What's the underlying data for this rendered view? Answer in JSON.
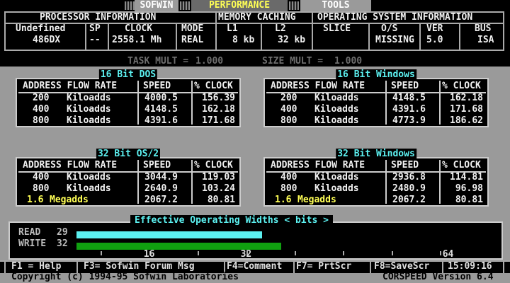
{
  "menu": {
    "items": [
      "SOFWIN",
      "PERFORMANCE",
      "TOOLS"
    ]
  },
  "info": {
    "headers": [
      "PROCESSOR INFORMATION",
      "MEMORY CACHING",
      "OPERATING SYSTEM INFORMATION"
    ],
    "labels": [
      "Undefined",
      "SP",
      "CLOCK",
      "MODE",
      "L1",
      "L2",
      "SLICE",
      "O/S",
      "VER",
      "BUS"
    ],
    "values": [
      "486DX",
      "--",
      "2558.1 Mh",
      "REAL",
      "8 kb",
      "32 kb",
      "",
      "MISSING",
      "5.0",
      "ISA"
    ]
  },
  "multipliers": {
    "task_label": "TASK MULT =",
    "task_value": "1.000",
    "size_label": "SIZE MULT =",
    "size_value": "1.000"
  },
  "table_headers": [
    "ADDRESS FLOW RATE",
    "SPEED",
    "% CLOCK"
  ],
  "tables": [
    {
      "title": "16 Bit DOS",
      "rows": [
        {
          "amount": "200",
          "unit": "Kiloadds",
          "speed": "4000.5",
          "clock": "156.39",
          "highlight": false
        },
        {
          "amount": "400",
          "unit": "Kiloadds",
          "speed": "4148.5",
          "clock": "162.18",
          "highlight": false
        },
        {
          "amount": "800",
          "unit": "Kiloadds",
          "speed": "4391.6",
          "clock": "171.68",
          "highlight": false
        }
      ]
    },
    {
      "title": "16 Bit Windows",
      "rows": [
        {
          "amount": "200",
          "unit": "Kiloadds",
          "speed": "4148.5",
          "clock": "162.18",
          "highlight": false
        },
        {
          "amount": "400",
          "unit": "Kiloadds",
          "speed": "4391.6",
          "clock": "171.68",
          "highlight": false
        },
        {
          "amount": "800",
          "unit": "Kiloadds",
          "speed": "4773.9",
          "clock": "186.62",
          "highlight": false
        }
      ]
    },
    {
      "title": "32 Bit OS/2",
      "rows": [
        {
          "amount": "400",
          "unit": "Kiloadds",
          "speed": "3044.9",
          "clock": "119.03",
          "highlight": false
        },
        {
          "amount": "800",
          "unit": "Kiloadds",
          "speed": "2640.9",
          "clock": "103.24",
          "highlight": false
        },
        {
          "amount": "1.6",
          "unit": "Megadds",
          "speed": "2067.2",
          "clock": "80.81",
          "highlight": true
        }
      ]
    },
    {
      "title": "32 Bit Windows",
      "rows": [
        {
          "amount": "400",
          "unit": "Kiloadds",
          "speed": "2936.8",
          "clock": "114.81",
          "highlight": false
        },
        {
          "amount": "800",
          "unit": "Kiloadds",
          "speed": "2480.9",
          "clock": "96.98",
          "highlight": false
        },
        {
          "amount": "1.6",
          "unit": "Megadds",
          "speed": "2067.2",
          "clock": "80.81",
          "highlight": true
        }
      ]
    }
  ],
  "widths": {
    "title": "Effective Operating Widths < bits >",
    "read_label": "READ",
    "read_value": "29",
    "write_label": "WRITE",
    "write_value": "32",
    "scale_max": 64,
    "ticks": [
      "16",
      "32",
      "64"
    ],
    "colors": {
      "read": "#5cf0f0",
      "write": "#10a010"
    }
  },
  "status": {
    "items": [
      "F1 = Help",
      "F3= Sofwin Forum Msg",
      "F4=Comment",
      "F7= PrtScr",
      "F8=SaveScr"
    ],
    "time": "15:09:16"
  },
  "footer": {
    "copyright": "Copyright (c) 1994-95 Sofwin Laboratories",
    "version": "CORSPEED Version 6.4"
  }
}
